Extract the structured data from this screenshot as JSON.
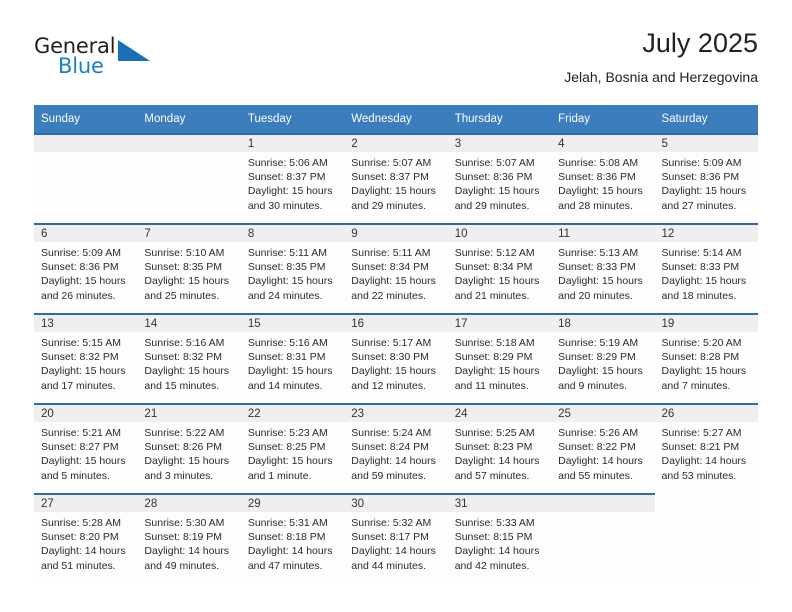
{
  "brand": {
    "name_part1": "General",
    "name_part2": "Blue",
    "logo_icon": "triangle-logo-icon"
  },
  "header": {
    "title": "July 2025",
    "subtitle": "Jelah, Bosnia and Herzegovina"
  },
  "calendar": {
    "weekday_headers": [
      "Sunday",
      "Monday",
      "Tuesday",
      "Wednesday",
      "Thursday",
      "Friday",
      "Saturday"
    ],
    "accent_color": "#3b7dbd",
    "row_border_color": "#2a6ca8",
    "daynum_strip_color": "#efefef",
    "weeks": [
      [
        {
          "day": "",
          "sunrise": "",
          "sunset": "",
          "daylight_line1": "",
          "daylight_line2": "",
          "state": "leading-blank"
        },
        {
          "day": "",
          "sunrise": "",
          "sunset": "",
          "daylight_line1": "",
          "daylight_line2": "",
          "state": "leading-blank"
        },
        {
          "day": "1",
          "sunrise": "Sunrise: 5:06 AM",
          "sunset": "Sunset: 8:37 PM",
          "daylight_line1": "Daylight: 15 hours",
          "daylight_line2": "and 30 minutes.",
          "state": "filled"
        },
        {
          "day": "2",
          "sunrise": "Sunrise: 5:07 AM",
          "sunset": "Sunset: 8:37 PM",
          "daylight_line1": "Daylight: 15 hours",
          "daylight_line2": "and 29 minutes.",
          "state": "filled"
        },
        {
          "day": "3",
          "sunrise": "Sunrise: 5:07 AM",
          "sunset": "Sunset: 8:36 PM",
          "daylight_line1": "Daylight: 15 hours",
          "daylight_line2": "and 29 minutes.",
          "state": "filled"
        },
        {
          "day": "4",
          "sunrise": "Sunrise: 5:08 AM",
          "sunset": "Sunset: 8:36 PM",
          "daylight_line1": "Daylight: 15 hours",
          "daylight_line2": "and 28 minutes.",
          "state": "filled"
        },
        {
          "day": "5",
          "sunrise": "Sunrise: 5:09 AM",
          "sunset": "Sunset: 8:36 PM",
          "daylight_line1": "Daylight: 15 hours",
          "daylight_line2": "and 27 minutes.",
          "state": "filled"
        }
      ],
      [
        {
          "day": "6",
          "sunrise": "Sunrise: 5:09 AM",
          "sunset": "Sunset: 8:36 PM",
          "daylight_line1": "Daylight: 15 hours",
          "daylight_line2": "and 26 minutes.",
          "state": "filled"
        },
        {
          "day": "7",
          "sunrise": "Sunrise: 5:10 AM",
          "sunset": "Sunset: 8:35 PM",
          "daylight_line1": "Daylight: 15 hours",
          "daylight_line2": "and 25 minutes.",
          "state": "filled"
        },
        {
          "day": "8",
          "sunrise": "Sunrise: 5:11 AM",
          "sunset": "Sunset: 8:35 PM",
          "daylight_line1": "Daylight: 15 hours",
          "daylight_line2": "and 24 minutes.",
          "state": "filled"
        },
        {
          "day": "9",
          "sunrise": "Sunrise: 5:11 AM",
          "sunset": "Sunset: 8:34 PM",
          "daylight_line1": "Daylight: 15 hours",
          "daylight_line2": "and 22 minutes.",
          "state": "filled"
        },
        {
          "day": "10",
          "sunrise": "Sunrise: 5:12 AM",
          "sunset": "Sunset: 8:34 PM",
          "daylight_line1": "Daylight: 15 hours",
          "daylight_line2": "and 21 minutes.",
          "state": "filled"
        },
        {
          "day": "11",
          "sunrise": "Sunrise: 5:13 AM",
          "sunset": "Sunset: 8:33 PM",
          "daylight_line1": "Daylight: 15 hours",
          "daylight_line2": "and 20 minutes.",
          "state": "filled"
        },
        {
          "day": "12",
          "sunrise": "Sunrise: 5:14 AM",
          "sunset": "Sunset: 8:33 PM",
          "daylight_line1": "Daylight: 15 hours",
          "daylight_line2": "and 18 minutes.",
          "state": "filled"
        }
      ],
      [
        {
          "day": "13",
          "sunrise": "Sunrise: 5:15 AM",
          "sunset": "Sunset: 8:32 PM",
          "daylight_line1": "Daylight: 15 hours",
          "daylight_line2": "and 17 minutes.",
          "state": "filled"
        },
        {
          "day": "14",
          "sunrise": "Sunrise: 5:16 AM",
          "sunset": "Sunset: 8:32 PM",
          "daylight_line1": "Daylight: 15 hours",
          "daylight_line2": "and 15 minutes.",
          "state": "filled"
        },
        {
          "day": "15",
          "sunrise": "Sunrise: 5:16 AM",
          "sunset": "Sunset: 8:31 PM",
          "daylight_line1": "Daylight: 15 hours",
          "daylight_line2": "and 14 minutes.",
          "state": "filled"
        },
        {
          "day": "16",
          "sunrise": "Sunrise: 5:17 AM",
          "sunset": "Sunset: 8:30 PM",
          "daylight_line1": "Daylight: 15 hours",
          "daylight_line2": "and 12 minutes.",
          "state": "filled"
        },
        {
          "day": "17",
          "sunrise": "Sunrise: 5:18 AM",
          "sunset": "Sunset: 8:29 PM",
          "daylight_line1": "Daylight: 15 hours",
          "daylight_line2": "and 11 minutes.",
          "state": "filled"
        },
        {
          "day": "18",
          "sunrise": "Sunrise: 5:19 AM",
          "sunset": "Sunset: 8:29 PM",
          "daylight_line1": "Daylight: 15 hours",
          "daylight_line2": "and 9 minutes.",
          "state": "filled"
        },
        {
          "day": "19",
          "sunrise": "Sunrise: 5:20 AM",
          "sunset": "Sunset: 8:28 PM",
          "daylight_line1": "Daylight: 15 hours",
          "daylight_line2": "and 7 minutes.",
          "state": "filled"
        }
      ],
      [
        {
          "day": "20",
          "sunrise": "Sunrise: 5:21 AM",
          "sunset": "Sunset: 8:27 PM",
          "daylight_line1": "Daylight: 15 hours",
          "daylight_line2": "and 5 minutes.",
          "state": "filled"
        },
        {
          "day": "21",
          "sunrise": "Sunrise: 5:22 AM",
          "sunset": "Sunset: 8:26 PM",
          "daylight_line1": "Daylight: 15 hours",
          "daylight_line2": "and 3 minutes.",
          "state": "filled"
        },
        {
          "day": "22",
          "sunrise": "Sunrise: 5:23 AM",
          "sunset": "Sunset: 8:25 PM",
          "daylight_line1": "Daylight: 15 hours",
          "daylight_line2": "and 1 minute.",
          "state": "filled"
        },
        {
          "day": "23",
          "sunrise": "Sunrise: 5:24 AM",
          "sunset": "Sunset: 8:24 PM",
          "daylight_line1": "Daylight: 14 hours",
          "daylight_line2": "and 59 minutes.",
          "state": "filled"
        },
        {
          "day": "24",
          "sunrise": "Sunrise: 5:25 AM",
          "sunset": "Sunset: 8:23 PM",
          "daylight_line1": "Daylight: 14 hours",
          "daylight_line2": "and 57 minutes.",
          "state": "filled"
        },
        {
          "day": "25",
          "sunrise": "Sunrise: 5:26 AM",
          "sunset": "Sunset: 8:22 PM",
          "daylight_line1": "Daylight: 14 hours",
          "daylight_line2": "and 55 minutes.",
          "state": "filled"
        },
        {
          "day": "26",
          "sunrise": "Sunrise: 5:27 AM",
          "sunset": "Sunset: 8:21 PM",
          "daylight_line1": "Daylight: 14 hours",
          "daylight_line2": "and 53 minutes.",
          "state": "filled"
        }
      ],
      [
        {
          "day": "27",
          "sunrise": "Sunrise: 5:28 AM",
          "sunset": "Sunset: 8:20 PM",
          "daylight_line1": "Daylight: 14 hours",
          "daylight_line2": "and 51 minutes.",
          "state": "filled"
        },
        {
          "day": "28",
          "sunrise": "Sunrise: 5:30 AM",
          "sunset": "Sunset: 8:19 PM",
          "daylight_line1": "Daylight: 14 hours",
          "daylight_line2": "and 49 minutes.",
          "state": "filled"
        },
        {
          "day": "29",
          "sunrise": "Sunrise: 5:31 AM",
          "sunset": "Sunset: 8:18 PM",
          "daylight_line1": "Daylight: 14 hours",
          "daylight_line2": "and 47 minutes.",
          "state": "filled"
        },
        {
          "day": "30",
          "sunrise": "Sunrise: 5:32 AM",
          "sunset": "Sunset: 8:17 PM",
          "daylight_line1": "Daylight: 14 hours",
          "daylight_line2": "and 44 minutes.",
          "state": "filled"
        },
        {
          "day": "31",
          "sunrise": "Sunrise: 5:33 AM",
          "sunset": "Sunset: 8:15 PM",
          "daylight_line1": "Daylight: 14 hours",
          "daylight_line2": "and 42 minutes.",
          "state": "filled"
        },
        {
          "day": "",
          "sunrise": "",
          "sunset": "",
          "daylight_line1": "",
          "daylight_line2": "",
          "state": "trailing-blank"
        },
        {
          "day": "",
          "sunrise": "",
          "sunset": "",
          "daylight_line1": "",
          "daylight_line2": "",
          "state": "void"
        }
      ]
    ]
  }
}
